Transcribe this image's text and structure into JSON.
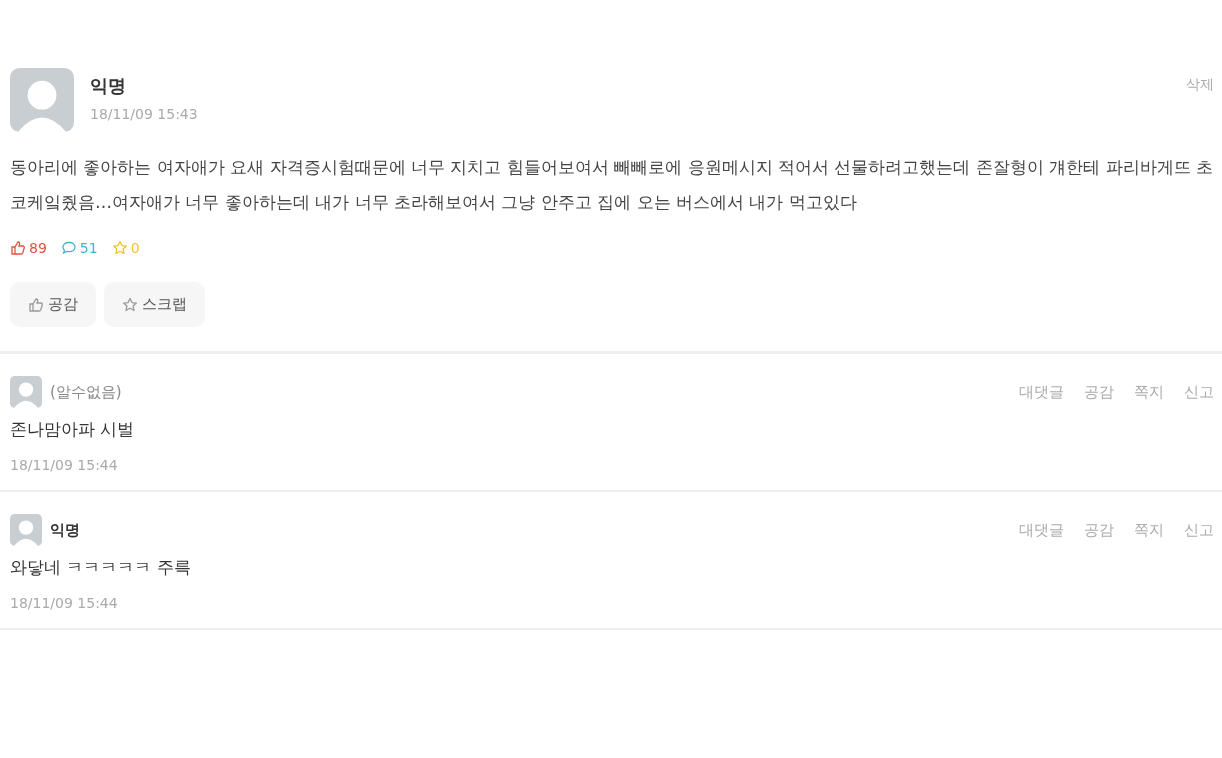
{
  "post": {
    "author": "익명",
    "time": "18/11/09 15:43",
    "delete": "삭제",
    "body": "동아리에 좋아하는 여자애가 요새 자격증시험때문에 너무 지치고 힘들어보여서 빼빼로에 응원메시지 적어서 선물하려고했는데 존잘형이 걔한테 파리바게뜨 초코케잌줬음…여자애가 너무 좋아하는데 내가 너무 초라해보여서 그냥 안주고 집에 오는 버스에서 내가 먹고있다",
    "stats": [
      {
        "kind": "like",
        "value": "89"
      },
      {
        "kind": "comment",
        "value": "51"
      },
      {
        "kind": "scrap",
        "value": "0"
      }
    ],
    "buttons": [
      {
        "kind": "like",
        "label": "공감"
      },
      {
        "kind": "scrap",
        "label": "스크랩"
      }
    ]
  },
  "comments": [
    {
      "author": "(알수없음)",
      "known": false,
      "text": "존나맘아파 시벌",
      "time": "18/11/09 15:44",
      "actions": [
        "대댓글",
        "공감",
        "쪽지",
        "신고"
      ]
    },
    {
      "author": "익명",
      "known": true,
      "text": "와닿네 ㅋㅋㅋㅋㅋ 주륵",
      "time": "18/11/09 15:44",
      "actions": [
        "대댓글",
        "공감",
        "쪽지",
        "신고"
      ]
    }
  ]
}
